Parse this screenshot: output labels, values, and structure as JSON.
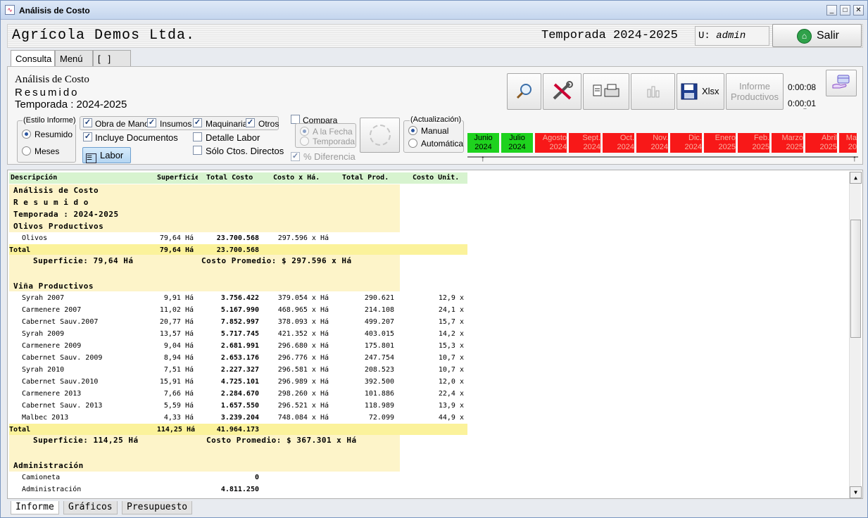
{
  "window": {
    "title": "Análisis de Costo",
    "minimize": "_",
    "maximize": "□",
    "close": "✕"
  },
  "header": {
    "company": "Agrícola Demos Ltda.",
    "season": "Temporada 2024-2025",
    "user_prefix": "U:",
    "user": "admin",
    "exit_label": "Salir"
  },
  "tabs": [
    "Consulta",
    "Menú",
    "[   ]"
  ],
  "info": {
    "title": "Análisis de Costo",
    "subtitle": "Resumido",
    "season": "Temporada : 2024-2025"
  },
  "toolbar": {
    "xlsx_label": "Xlsx",
    "informe_line1": "Informe",
    "informe_line2": "Productivos",
    "timer1": "0:00:08",
    "timer2": "0:00:01",
    "timer_dots": ".."
  },
  "estilo": {
    "label": "(Estilo Informe)",
    "options": [
      "Resumido",
      "Meses"
    ],
    "selected": "Resumido"
  },
  "checks": {
    "obra": "Obra de Mano",
    "insumos": "Insumos",
    "maquinaria": "Maquinaria",
    "otros": "Otros",
    "documentos": "Incluye Documentos",
    "detalle": "Detalle Labor",
    "solo": "Sólo Ctos. Directos",
    "labor_button": "Labor"
  },
  "compara": {
    "label": "Compara",
    "opt1": "A la Fecha",
    "opt2": "Temporada",
    "diff": "% Diferencia"
  },
  "actualizacion": {
    "label": "(Actualización)",
    "opt1": "Manual",
    "opt2": "Automática",
    "selected": "Manual"
  },
  "months": [
    {
      "m": "Junio",
      "y": "2024",
      "status": "green"
    },
    {
      "m": "Julio",
      "y": "2024",
      "status": "green"
    },
    {
      "m": "Agosto",
      "y": "2024",
      "status": "red"
    },
    {
      "m": "Sept.",
      "y": "2024",
      "status": "red"
    },
    {
      "m": "Oct.",
      "y": "2024",
      "status": "red"
    },
    {
      "m": "Nov.",
      "y": "2024",
      "status": "red"
    },
    {
      "m": "Dic.",
      "y": "2024",
      "status": "red"
    },
    {
      "m": "Enero",
      "y": "2025",
      "status": "red"
    },
    {
      "m": "Feb.",
      "y": "2025",
      "status": "red"
    },
    {
      "m": "Marzo",
      "y": "2025",
      "status": "red"
    },
    {
      "m": "Abril",
      "y": "2025",
      "status": "red"
    },
    {
      "m": "Ma",
      "y": "20",
      "status": "red"
    }
  ],
  "report": {
    "columns": [
      "Descripción",
      "Superficie",
      "Total Costo",
      "Costo x Há.",
      "Total Prod.",
      "Costo Unit."
    ],
    "title_lines": [
      "Análisis de Costo",
      "R e s u m i d o",
      "Temporada : 2024-2025"
    ],
    "olivos": {
      "title": "Olivos Productivos",
      "rows": [
        [
          "Olivos",
          "79,64 Há",
          "23.700.568",
          "297.596 x Há",
          "",
          ""
        ]
      ],
      "total_label": "Total",
      "total_sup": "79,64 Há",
      "total_cost": "23.700.568",
      "summary_sup": "Superficie: 79,64 Há",
      "summary_avg": "Costo Promedio: $ 297.596 x Há"
    },
    "vina": {
      "title": "Viña Productivos",
      "rows": [
        [
          "Syrah 2007",
          "9,91 Há",
          "3.756.422",
          "379.054 x Há",
          "290.621",
          "12,9 x"
        ],
        [
          "Carmenere 2007",
          "11,02 Há",
          "5.167.990",
          "468.965 x Há",
          "214.108",
          "24,1 x"
        ],
        [
          "Cabernet Sauv.2007",
          "20,77 Há",
          "7.852.997",
          "378.093 x Há",
          "499.207",
          "15,7 x"
        ],
        [
          "Syrah 2009",
          "13,57 Há",
          "5.717.745",
          "421.352 x Há",
          "403.015",
          "14,2 x"
        ],
        [
          "Carmenere 2009",
          "9,04 Há",
          "2.681.991",
          "296.680 x Há",
          "175.801",
          "15,3 x"
        ],
        [
          "Cabernet Sauv. 2009",
          "8,94 Há",
          "2.653.176",
          "296.776 x Há",
          "247.754",
          "10,7 x"
        ],
        [
          "Syrah 2010",
          "7,51 Há",
          "2.227.327",
          "296.581 x Há",
          "208.523",
          "10,7 x"
        ],
        [
          "Cabernet Sauv.2010",
          "15,91 Há",
          "4.725.101",
          "296.989 x Há",
          "392.500",
          "12,0 x"
        ],
        [
          "Carmenere 2013",
          "7,66 Há",
          "2.284.670",
          "298.260 x Há",
          "101.886",
          "22,4 x"
        ],
        [
          "Cabernet Sauv. 2013",
          "5,59 Há",
          "1.657.550",
          "296.521 x Há",
          "118.989",
          "13,9 x"
        ],
        [
          "Malbec 2013",
          "4,33 Há",
          "3.239.204",
          "748.084 x Há",
          "72.099",
          "44,9 x"
        ]
      ],
      "total_label": "Total",
      "total_sup": "114,25 Há",
      "total_cost": "41.964.173",
      "summary_sup": "Superficie: 114,25 Há",
      "summary_avg": "Costo Promedio: $ 367.301 x Há"
    },
    "admin": {
      "title": "Administración",
      "rows": [
        [
          "Camioneta",
          "",
          "0",
          "",
          "",
          ""
        ],
        [
          "Administración",
          "",
          "4.811.250",
          "",
          "",
          ""
        ]
      ]
    }
  },
  "bottom_tabs": [
    "Informe",
    "Gráficos",
    "Presupuesto"
  ],
  "colors": {
    "green_month": "#1ed21e",
    "red_month": "#f81818",
    "header_row": "#d7f3cf",
    "total_row": "#fbf29b",
    "section_bg": "#fdf4c9"
  }
}
